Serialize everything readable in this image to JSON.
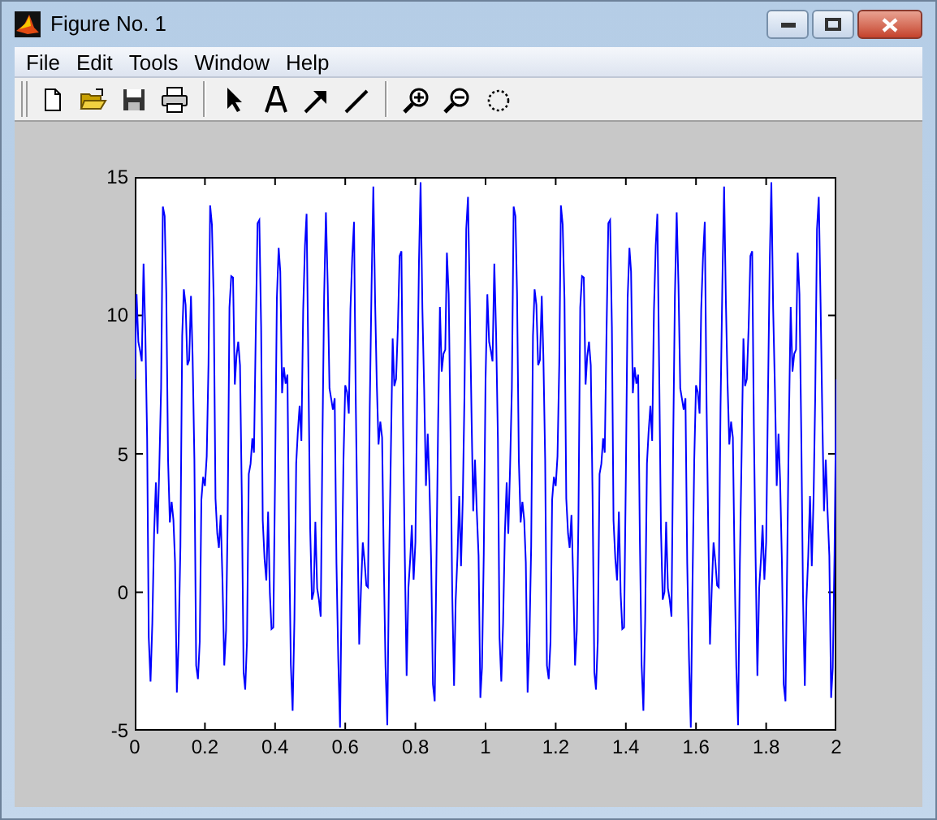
{
  "window": {
    "title": "Figure No. 1"
  },
  "menu": [
    "File",
    "Edit",
    "Tools",
    "Window",
    "Help"
  ],
  "toolbar": [
    {
      "kind": "new"
    },
    {
      "kind": "open"
    },
    {
      "kind": "save"
    },
    {
      "kind": "print"
    },
    {
      "kind": "separator"
    },
    {
      "kind": "pointer"
    },
    {
      "kind": "text"
    },
    {
      "kind": "arrow"
    },
    {
      "kind": "line"
    },
    {
      "kind": "separator"
    },
    {
      "kind": "zoom-in"
    },
    {
      "kind": "zoom-out"
    },
    {
      "kind": "rotate"
    }
  ],
  "plot": {
    "x_tick_labels": [
      "0",
      "0.2",
      "0.4",
      "0.6",
      "0.8",
      "1",
      "1.2",
      "1.4",
      "1.6",
      "1.8",
      "2"
    ],
    "y_tick_labels": [
      "15",
      "10",
      "5",
      "0",
      "-5"
    ]
  }
}
